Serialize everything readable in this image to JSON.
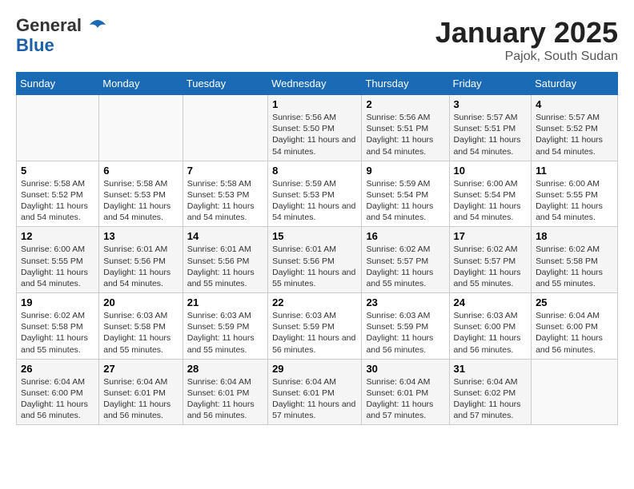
{
  "header": {
    "logo_line1": "General",
    "logo_line2": "Blue",
    "month": "January 2025",
    "location": "Pajok, South Sudan"
  },
  "weekdays": [
    "Sunday",
    "Monday",
    "Tuesday",
    "Wednesday",
    "Thursday",
    "Friday",
    "Saturday"
  ],
  "weeks": [
    [
      {
        "day": "",
        "info": ""
      },
      {
        "day": "",
        "info": ""
      },
      {
        "day": "",
        "info": ""
      },
      {
        "day": "1",
        "info": "Sunrise: 5:56 AM\nSunset: 5:50 PM\nDaylight: 11 hours and 54 minutes."
      },
      {
        "day": "2",
        "info": "Sunrise: 5:56 AM\nSunset: 5:51 PM\nDaylight: 11 hours and 54 minutes."
      },
      {
        "day": "3",
        "info": "Sunrise: 5:57 AM\nSunset: 5:51 PM\nDaylight: 11 hours and 54 minutes."
      },
      {
        "day": "4",
        "info": "Sunrise: 5:57 AM\nSunset: 5:52 PM\nDaylight: 11 hours and 54 minutes."
      }
    ],
    [
      {
        "day": "5",
        "info": "Sunrise: 5:58 AM\nSunset: 5:52 PM\nDaylight: 11 hours and 54 minutes."
      },
      {
        "day": "6",
        "info": "Sunrise: 5:58 AM\nSunset: 5:53 PM\nDaylight: 11 hours and 54 minutes."
      },
      {
        "day": "7",
        "info": "Sunrise: 5:58 AM\nSunset: 5:53 PM\nDaylight: 11 hours and 54 minutes."
      },
      {
        "day": "8",
        "info": "Sunrise: 5:59 AM\nSunset: 5:53 PM\nDaylight: 11 hours and 54 minutes."
      },
      {
        "day": "9",
        "info": "Sunrise: 5:59 AM\nSunset: 5:54 PM\nDaylight: 11 hours and 54 minutes."
      },
      {
        "day": "10",
        "info": "Sunrise: 6:00 AM\nSunset: 5:54 PM\nDaylight: 11 hours and 54 minutes."
      },
      {
        "day": "11",
        "info": "Sunrise: 6:00 AM\nSunset: 5:55 PM\nDaylight: 11 hours and 54 minutes."
      }
    ],
    [
      {
        "day": "12",
        "info": "Sunrise: 6:00 AM\nSunset: 5:55 PM\nDaylight: 11 hours and 54 minutes."
      },
      {
        "day": "13",
        "info": "Sunrise: 6:01 AM\nSunset: 5:56 PM\nDaylight: 11 hours and 54 minutes."
      },
      {
        "day": "14",
        "info": "Sunrise: 6:01 AM\nSunset: 5:56 PM\nDaylight: 11 hours and 55 minutes."
      },
      {
        "day": "15",
        "info": "Sunrise: 6:01 AM\nSunset: 5:56 PM\nDaylight: 11 hours and 55 minutes."
      },
      {
        "day": "16",
        "info": "Sunrise: 6:02 AM\nSunset: 5:57 PM\nDaylight: 11 hours and 55 minutes."
      },
      {
        "day": "17",
        "info": "Sunrise: 6:02 AM\nSunset: 5:57 PM\nDaylight: 11 hours and 55 minutes."
      },
      {
        "day": "18",
        "info": "Sunrise: 6:02 AM\nSunset: 5:58 PM\nDaylight: 11 hours and 55 minutes."
      }
    ],
    [
      {
        "day": "19",
        "info": "Sunrise: 6:02 AM\nSunset: 5:58 PM\nDaylight: 11 hours and 55 minutes."
      },
      {
        "day": "20",
        "info": "Sunrise: 6:03 AM\nSunset: 5:58 PM\nDaylight: 11 hours and 55 minutes."
      },
      {
        "day": "21",
        "info": "Sunrise: 6:03 AM\nSunset: 5:59 PM\nDaylight: 11 hours and 55 minutes."
      },
      {
        "day": "22",
        "info": "Sunrise: 6:03 AM\nSunset: 5:59 PM\nDaylight: 11 hours and 56 minutes."
      },
      {
        "day": "23",
        "info": "Sunrise: 6:03 AM\nSunset: 5:59 PM\nDaylight: 11 hours and 56 minutes."
      },
      {
        "day": "24",
        "info": "Sunrise: 6:03 AM\nSunset: 6:00 PM\nDaylight: 11 hours and 56 minutes."
      },
      {
        "day": "25",
        "info": "Sunrise: 6:04 AM\nSunset: 6:00 PM\nDaylight: 11 hours and 56 minutes."
      }
    ],
    [
      {
        "day": "26",
        "info": "Sunrise: 6:04 AM\nSunset: 6:00 PM\nDaylight: 11 hours and 56 minutes."
      },
      {
        "day": "27",
        "info": "Sunrise: 6:04 AM\nSunset: 6:01 PM\nDaylight: 11 hours and 56 minutes."
      },
      {
        "day": "28",
        "info": "Sunrise: 6:04 AM\nSunset: 6:01 PM\nDaylight: 11 hours and 56 minutes."
      },
      {
        "day": "29",
        "info": "Sunrise: 6:04 AM\nSunset: 6:01 PM\nDaylight: 11 hours and 57 minutes."
      },
      {
        "day": "30",
        "info": "Sunrise: 6:04 AM\nSunset: 6:01 PM\nDaylight: 11 hours and 57 minutes."
      },
      {
        "day": "31",
        "info": "Sunrise: 6:04 AM\nSunset: 6:02 PM\nDaylight: 11 hours and 57 minutes."
      },
      {
        "day": "",
        "info": ""
      }
    ]
  ]
}
